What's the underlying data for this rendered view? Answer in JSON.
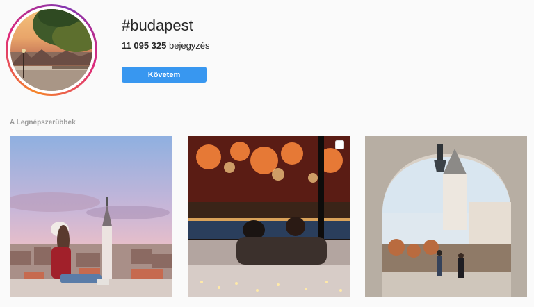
{
  "hashtag": {
    "title": "#budapest",
    "post_count": "11 095 325",
    "post_count_label": "bejegyzés",
    "follow_label": "Követem"
  },
  "top_posts": {
    "section_title": "A Legnépszerűbbek",
    "posts": [
      {
        "name": "post-cathedral-view"
      },
      {
        "name": "post-fireworks-window",
        "multiple": true
      },
      {
        "name": "post-fishermans-bastion"
      }
    ]
  },
  "colors": {
    "accent": "#3897f0",
    "muted_text": "#999999"
  }
}
